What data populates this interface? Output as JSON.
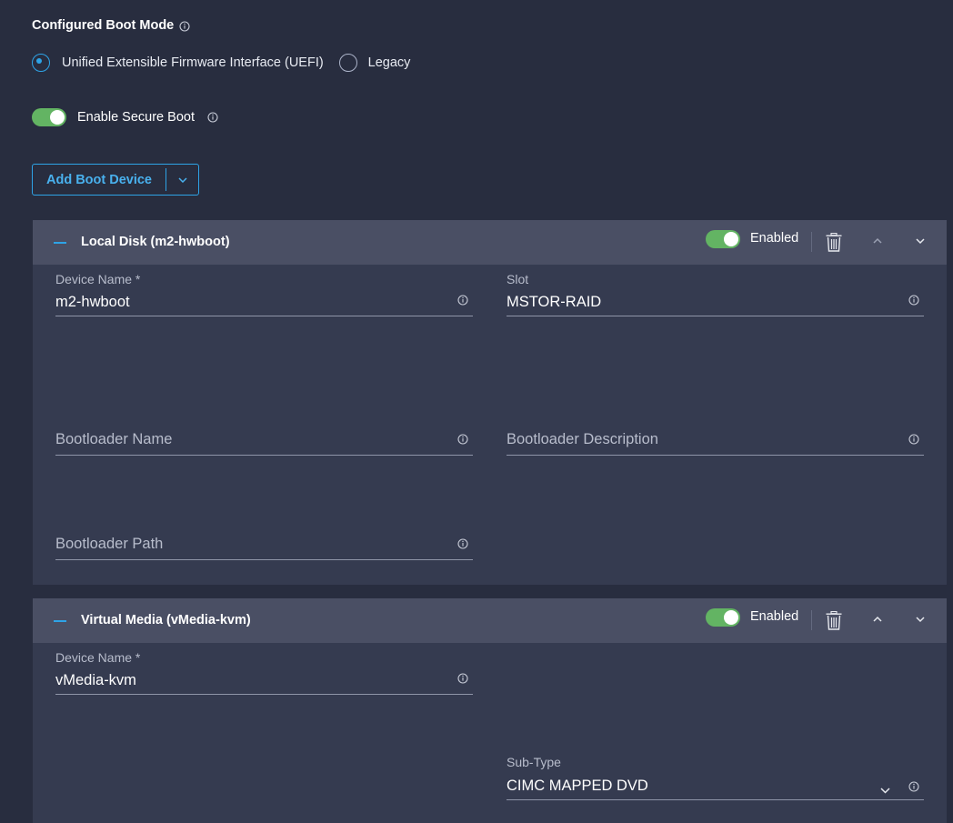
{
  "boot_mode": {
    "label": "Configured Boot Mode",
    "options": [
      {
        "label": "Unified Extensible Firmware Interface (UEFI)",
        "selected": true
      },
      {
        "label": "Legacy",
        "selected": false
      }
    ]
  },
  "secure_boot": {
    "label": "Enable Secure Boot",
    "enabled": true
  },
  "add_boot_device": {
    "label": "Add Boot Device"
  },
  "devices": [
    {
      "title": "Local Disk (m2-hwboot)",
      "enabled_label": "Enabled",
      "enabled": true,
      "device_name": {
        "label": "Device Name *",
        "value": "m2-hwboot"
      },
      "slot": {
        "label": "Slot",
        "value": "MSTOR-RAID"
      },
      "bootloader_name": {
        "placeholder": "Bootloader Name"
      },
      "bootloader_description": {
        "placeholder": "Bootloader Description"
      },
      "bootloader_path": {
        "placeholder": "Bootloader Path"
      }
    },
    {
      "title": "Virtual Media (vMedia-kvm)",
      "enabled_label": "Enabled",
      "enabled": true,
      "device_name": {
        "label": "Device Name *",
        "value": "vMedia-kvm"
      },
      "sub_type": {
        "label": "Sub-Type",
        "value": "CIMC MAPPED DVD"
      }
    }
  ],
  "colors": {
    "background": "#282d3f",
    "panel": "#353b50",
    "panel_header": "#4a4f64",
    "accent": "#2ea3e6",
    "toggle_on": "#63b463"
  }
}
